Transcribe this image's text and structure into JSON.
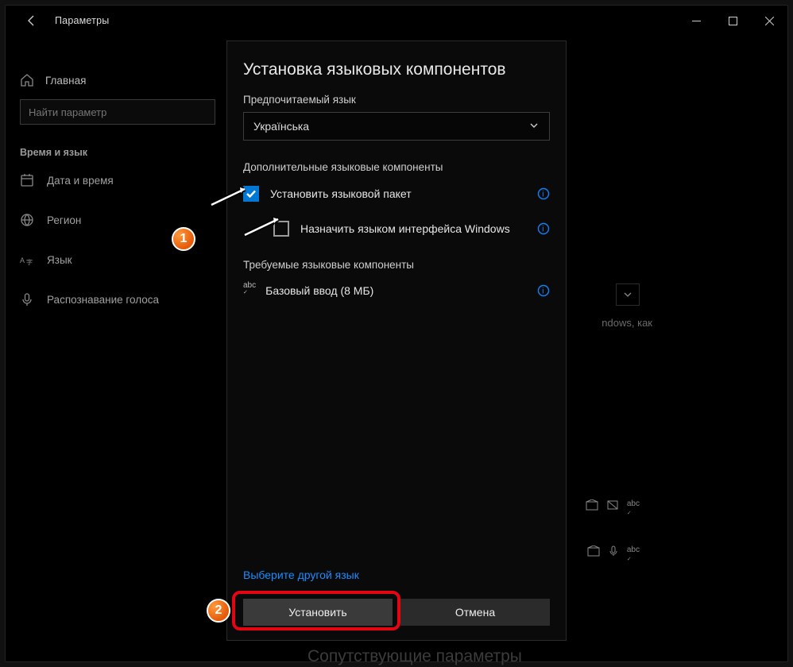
{
  "app": {
    "title": "Параметры"
  },
  "sidebar": {
    "home": "Главная",
    "search_placeholder": "Найти параметр",
    "section": "Время и язык",
    "items": [
      {
        "label": "Дата и время"
      },
      {
        "label": "Регион"
      },
      {
        "label": "Язык"
      },
      {
        "label": "Распознавание голоса"
      }
    ]
  },
  "dialog": {
    "title": "Установка языковых компонентов",
    "preferred_label": "Предпочитаемый язык",
    "preferred_value": "Українська",
    "optional_label": "Дополнительные языковые компоненты",
    "option_install_pack": "Установить языковой пакет",
    "option_set_display": "Назначить языком интерфейса Windows",
    "required_label": "Требуемые языковые компоненты",
    "required_item": "Базовый ввод (8 МБ)",
    "choose_other": "Выберите другой язык",
    "install_btn": "Установить",
    "cancel_btn": "Отмена"
  },
  "background": {
    "text_fragment": "ndows, как",
    "related_heading": "Сопутствующие параметры"
  },
  "annotations": {
    "marker1": "1",
    "marker2": "2"
  }
}
